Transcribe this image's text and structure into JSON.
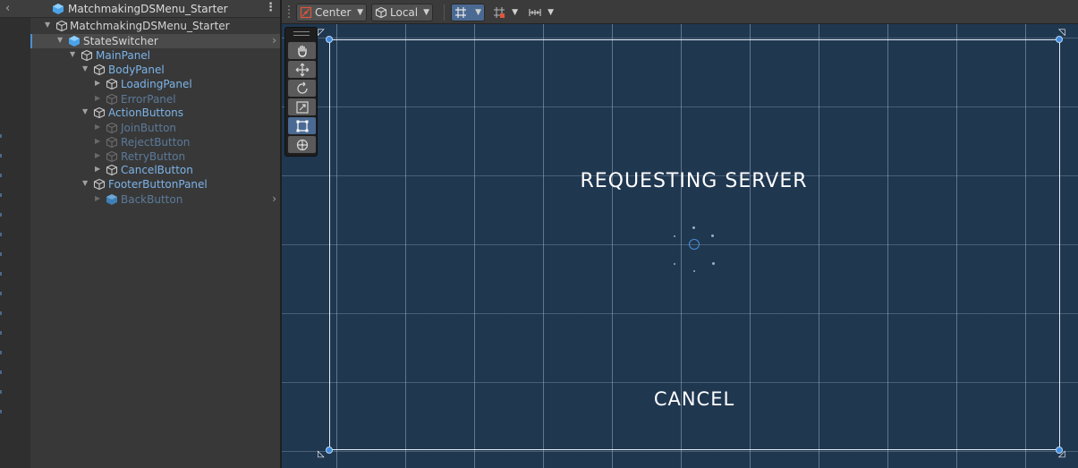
{
  "hierarchy": {
    "scene_name": "MatchmakingDSMenu_Starter",
    "items": [
      {
        "label": "MatchmakingDSMenu_Starter"
      },
      {
        "label": "StateSwitcher"
      },
      {
        "label": "MainPanel"
      },
      {
        "label": "BodyPanel"
      },
      {
        "label": "LoadingPanel"
      },
      {
        "label": "ErrorPanel"
      },
      {
        "label": "ActionButtons"
      },
      {
        "label": "JoinButton"
      },
      {
        "label": "RejectButton"
      },
      {
        "label": "RetryButton"
      },
      {
        "label": "CancelButton"
      },
      {
        "label": "FooterButtonPanel"
      },
      {
        "label": "BackButton"
      }
    ]
  },
  "toolbar": {
    "pivot_label": "Center",
    "space_label": "Local"
  },
  "scene": {
    "title_text": "REQUESTING SERVER",
    "cancel_text": "CANCEL"
  },
  "colors": {
    "scene_bg": "#203750",
    "selection_accent": "#4c8fd1",
    "active_tool": "#4b6a93"
  },
  "tools": [
    "hand-tool",
    "move-tool",
    "rotate-tool",
    "scale-tool",
    "rect-tool",
    "transform-tool"
  ]
}
